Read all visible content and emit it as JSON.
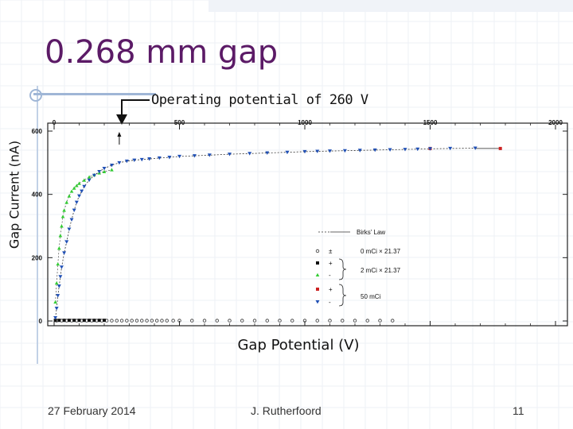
{
  "slide": {
    "title": "0.268 mm gap",
    "annotation": "Operating potential of 260 V",
    "date": "27 February 2014",
    "author": "J. Rutherfoord",
    "page": "11"
  },
  "chart_data": {
    "type": "scatter",
    "xlabel": "Gap Potential (V)",
    "ylabel": "Gap Current (nA)",
    "xlim": [
      0,
      2000
    ],
    "ylim": [
      0,
      600
    ],
    "x_ticks": [
      "0",
      "500",
      "1000",
      "1500",
      "2000"
    ],
    "y_ticks": [
      "0",
      "200",
      "400",
      "600"
    ],
    "marker_at_x": 260,
    "legend": {
      "placement": "lower-right",
      "curve_label": "Birks' Law",
      "groups": [
        {
          "label": "0 mCi × 21.37",
          "signs": [
            "±"
          ]
        },
        {
          "label": "2 mCi × 21.37",
          "signs": [
            "+",
            "-"
          ]
        },
        {
          "label": "50 mCi",
          "signs": [
            "+",
            "-"
          ]
        }
      ]
    },
    "series": [
      {
        "color": "#333333",
        "marker": "circle-open",
        "points": [
          [
            10,
            1
          ],
          [
            30,
            1
          ],
          [
            50,
            1
          ],
          [
            70,
            1
          ],
          [
            90,
            1
          ],
          [
            110,
            1
          ],
          [
            130,
            1
          ],
          [
            150,
            1
          ],
          [
            170,
            1
          ],
          [
            190,
            1
          ],
          [
            210,
            1
          ],
          [
            230,
            1
          ],
          [
            250,
            1
          ],
          [
            270,
            1
          ],
          [
            290,
            1
          ],
          [
            310,
            1
          ],
          [
            330,
            1
          ],
          [
            350,
            1
          ],
          [
            370,
            1
          ],
          [
            390,
            1
          ],
          [
            410,
            1
          ],
          [
            430,
            1
          ],
          [
            450,
            1
          ],
          [
            475,
            1
          ],
          [
            500,
            1
          ],
          [
            550,
            1
          ],
          [
            600,
            1
          ],
          [
            650,
            1
          ],
          [
            700,
            1
          ],
          [
            750,
            1
          ],
          [
            800,
            1
          ],
          [
            850,
            1
          ],
          [
            900,
            1
          ],
          [
            950,
            1
          ],
          [
            1000,
            1
          ],
          [
            1050,
            1
          ],
          [
            1100,
            1
          ],
          [
            1150,
            1
          ],
          [
            1200,
            1
          ],
          [
            1250,
            1
          ],
          [
            1300,
            1
          ],
          [
            1350,
            1
          ]
        ]
      },
      {
        "color": "#111111",
        "marker": "square",
        "points": [
          [
            5,
            2
          ],
          [
            20,
            2
          ],
          [
            40,
            2
          ],
          [
            60,
            2
          ],
          [
            80,
            2
          ],
          [
            100,
            2
          ],
          [
            120,
            2
          ],
          [
            140,
            2
          ],
          [
            160,
            2
          ],
          [
            180,
            2
          ],
          [
            200,
            2
          ]
        ]
      },
      {
        "color": "#33cc33",
        "marker": "triangle-up",
        "points": [
          [
            5,
            60
          ],
          [
            10,
            120
          ],
          [
            15,
            180
          ],
          [
            20,
            230
          ],
          [
            25,
            270
          ],
          [
            30,
            300
          ],
          [
            35,
            330
          ],
          [
            40,
            350
          ],
          [
            50,
            375
          ],
          [
            60,
            395
          ],
          [
            70,
            410
          ],
          [
            80,
            420
          ],
          [
            90,
            428
          ],
          [
            100,
            435
          ],
          [
            120,
            445
          ],
          [
            140,
            455
          ],
          [
            160,
            462
          ],
          [
            180,
            468
          ],
          [
            200,
            472
          ],
          [
            230,
            478
          ]
        ]
      },
      {
        "color": "#cc2222",
        "marker": "square",
        "points": [
          [
            1500,
            545
          ],
          [
            1780,
            545
          ]
        ]
      },
      {
        "color": "#1f4fb5",
        "marker": "triangle-down",
        "points": [
          [
            5,
            10
          ],
          [
            10,
            40
          ],
          [
            15,
            80
          ],
          [
            20,
            110
          ],
          [
            25,
            140
          ],
          [
            30,
            170
          ],
          [
            40,
            215
          ],
          [
            50,
            250
          ],
          [
            60,
            290
          ],
          [
            70,
            320
          ],
          [
            80,
            350
          ],
          [
            90,
            375
          ],
          [
            100,
            395
          ],
          [
            110,
            410
          ],
          [
            120,
            425
          ],
          [
            140,
            445
          ],
          [
            160,
            460
          ],
          [
            180,
            472
          ],
          [
            200,
            482
          ],
          [
            230,
            492
          ],
          [
            260,
            500
          ],
          [
            290,
            505
          ],
          [
            320,
            508
          ],
          [
            350,
            510
          ],
          [
            380,
            512
          ],
          [
            420,
            515
          ],
          [
            460,
            517
          ],
          [
            500,
            520
          ],
          [
            560,
            522
          ],
          [
            620,
            524
          ],
          [
            700,
            527
          ],
          [
            780,
            529
          ],
          [
            850,
            531
          ],
          [
            930,
            533
          ],
          [
            1000,
            535
          ],
          [
            1050,
            536
          ],
          [
            1100,
            537
          ],
          [
            1160,
            538
          ],
          [
            1220,
            539
          ],
          [
            1280,
            540
          ],
          [
            1340,
            541
          ],
          [
            1400,
            542
          ],
          [
            1450,
            543
          ],
          [
            1500,
            544
          ],
          [
            1580,
            545
          ],
          [
            1680,
            546
          ]
        ]
      }
    ]
  }
}
